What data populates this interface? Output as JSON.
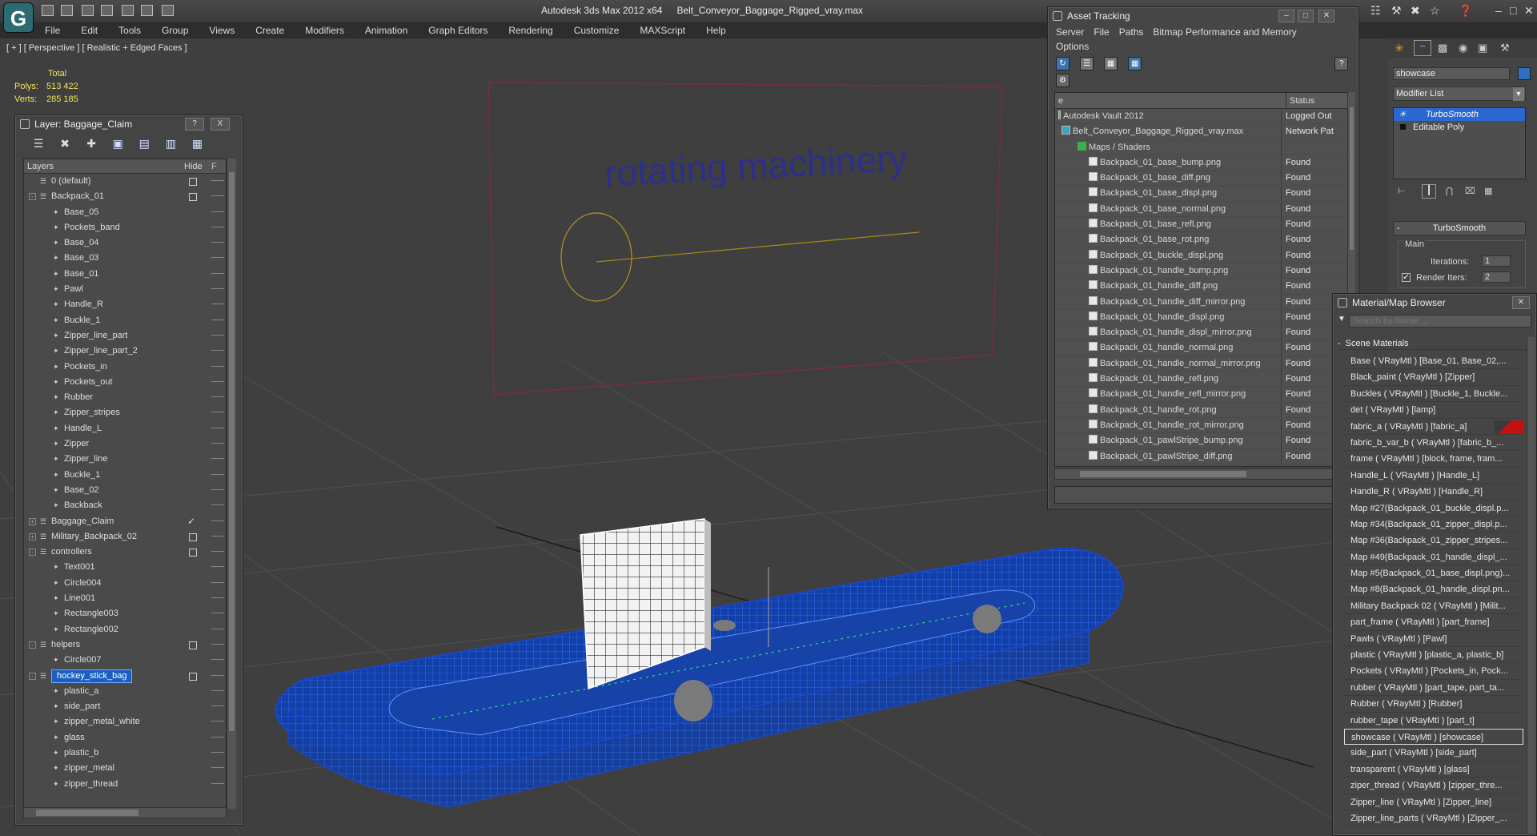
{
  "app": {
    "logo": "G",
    "title": "Autodesk 3ds Max  2012 x64",
    "file": "Belt_Conveyor_Baggage_Rigged_vray.max"
  },
  "menu": [
    "File",
    "Edit",
    "Tools",
    "Group",
    "Views",
    "Create",
    "Modifiers",
    "Animation",
    "Graph Editors",
    "Rendering",
    "Customize",
    "MAXScript",
    "Help"
  ],
  "viewport": {
    "label": "[ + ] [ Perspective ] [ Realistic + Edged Faces ]",
    "stats_header": "Total",
    "polys_label": "Polys:",
    "polys_value": "513 422",
    "verts_label": "Verts:",
    "verts_value": "285 185",
    "scene_text": "rotating machinery"
  },
  "layer_panel": {
    "title": "Layer: Baggage_Claim",
    "help_btn": "?",
    "close_btn": "X",
    "col_layers": "Layers",
    "col_hide": "Hide",
    "col_f": "F",
    "rows": [
      {
        "name": "0 (default)",
        "depth": 0,
        "box": true,
        "check": false,
        "expander": ""
      },
      {
        "name": "Backpack_01",
        "depth": 0,
        "box": true,
        "check": false,
        "expander": "-"
      },
      {
        "name": "Base_05",
        "depth": 1
      },
      {
        "name": "Pockets_band",
        "depth": 1
      },
      {
        "name": "Base_04",
        "depth": 1
      },
      {
        "name": "Base_03",
        "depth": 1
      },
      {
        "name": "Base_01",
        "depth": 1
      },
      {
        "name": "Pawl",
        "depth": 1
      },
      {
        "name": "Handle_R",
        "depth": 1
      },
      {
        "name": "Buckle_1",
        "depth": 1
      },
      {
        "name": "Zipper_line_part",
        "depth": 1
      },
      {
        "name": "Zipper_line_part_2",
        "depth": 1
      },
      {
        "name": "Pockets_in",
        "depth": 1
      },
      {
        "name": "Pockets_out",
        "depth": 1
      },
      {
        "name": "Rubber",
        "depth": 1
      },
      {
        "name": "Zipper_stripes",
        "depth": 1
      },
      {
        "name": "Handle_L",
        "depth": 1
      },
      {
        "name": "Zipper",
        "depth": 1
      },
      {
        "name": "Zipper_line",
        "depth": 1
      },
      {
        "name": "Buckle_1",
        "depth": 1
      },
      {
        "name": "Base_02",
        "depth": 1
      },
      {
        "name": "Backback",
        "depth": 1
      },
      {
        "name": "Baggage_Claim",
        "depth": 0,
        "check": true,
        "expander": "+"
      },
      {
        "name": "Military_Backpack_02",
        "depth": 0,
        "box": true,
        "expander": "+"
      },
      {
        "name": "controllers",
        "depth": 0,
        "box": true,
        "expander": "-"
      },
      {
        "name": "Text001",
        "depth": 1
      },
      {
        "name": "Circle004",
        "depth": 1
      },
      {
        "name": "Line001",
        "depth": 1
      },
      {
        "name": "Rectangle003",
        "depth": 1
      },
      {
        "name": "Rectangle002",
        "depth": 1
      },
      {
        "name": "helpers",
        "depth": 0,
        "box": true,
        "expander": "-"
      },
      {
        "name": "Circle007",
        "depth": 1
      },
      {
        "name": "hockey_stick_bag",
        "depth": 0,
        "box": true,
        "expander": "-",
        "selected": true
      },
      {
        "name": "plastic_a",
        "depth": 1
      },
      {
        "name": "side_part",
        "depth": 1
      },
      {
        "name": "zipper_metal_white",
        "depth": 1
      },
      {
        "name": "glass",
        "depth": 1
      },
      {
        "name": "plastic_b",
        "depth": 1
      },
      {
        "name": "zipper_metal",
        "depth": 1
      },
      {
        "name": "zipper_thread",
        "depth": 1
      }
    ]
  },
  "asset_tracking": {
    "title": "Asset Tracking",
    "menu": [
      "Server",
      "File",
      "Paths",
      "Bitmap Performance and Memory"
    ],
    "menu2": [
      "Options"
    ],
    "col_name": "e",
    "col_status": "Status",
    "rows": [
      {
        "name": "Autodesk Vault 2012",
        "status": "Logged Out",
        "depth": 0,
        "icon": "vault"
      },
      {
        "name": "Belt_Conveyor_Baggage_Rigged_vray.max",
        "status": "Network Pat",
        "depth": 0,
        "icon": "max"
      },
      {
        "name": "Maps / Shaders",
        "status": "",
        "depth": 1,
        "icon": "maps"
      },
      {
        "name": "Backpack_01_base_bump.png",
        "status": "Found",
        "depth": 2
      },
      {
        "name": "Backpack_01_base_diff.png",
        "status": "Found",
        "depth": 2
      },
      {
        "name": "Backpack_01_base_displ.png",
        "status": "Found",
        "depth": 2
      },
      {
        "name": "Backpack_01_base_normal.png",
        "status": "Found",
        "depth": 2
      },
      {
        "name": "Backpack_01_base_refl.png",
        "status": "Found",
        "depth": 2
      },
      {
        "name": "Backpack_01_base_rot.png",
        "status": "Found",
        "depth": 2
      },
      {
        "name": "Backpack_01_buckle_displ.png",
        "status": "Found",
        "depth": 2
      },
      {
        "name": "Backpack_01_handle_bump.png",
        "status": "Found",
        "depth": 2
      },
      {
        "name": "Backpack_01_handle_diff.png",
        "status": "Found",
        "depth": 2
      },
      {
        "name": "Backpack_01_handle_diff_mirror.png",
        "status": "Found",
        "depth": 2
      },
      {
        "name": "Backpack_01_handle_displ.png",
        "status": "Found",
        "depth": 2
      },
      {
        "name": "Backpack_01_handle_displ_mirror.png",
        "status": "Found",
        "depth": 2
      },
      {
        "name": "Backpack_01_handle_normal.png",
        "status": "Found",
        "depth": 2
      },
      {
        "name": "Backpack_01_handle_normal_mirror.png",
        "status": "Found",
        "depth": 2
      },
      {
        "name": "Backpack_01_handle_refl.png",
        "status": "Found",
        "depth": 2
      },
      {
        "name": "Backpack_01_handle_refl_mirror.png",
        "status": "Found",
        "depth": 2
      },
      {
        "name": "Backpack_01_handle_rot.png",
        "status": "Found",
        "depth": 2
      },
      {
        "name": "Backpack_01_handle_rot_mirror.png",
        "status": "Found",
        "depth": 2
      },
      {
        "name": "Backpack_01_pawlStripe_bump.png",
        "status": "Found",
        "depth": 2
      },
      {
        "name": "Backpack_01_pawlStripe_diff.png",
        "status": "Found",
        "depth": 2
      }
    ]
  },
  "command_panel": {
    "object_name": "showcase",
    "modifier_list": "Modifier List",
    "stack": [
      "TurboSmooth",
      "Editable Poly"
    ],
    "rollout_title": "TurboSmooth",
    "group_main": "Main",
    "iterations_label": "Iterations:",
    "iterations_value": "1",
    "render_iters_label": "Render Iters:",
    "render_iters_value": "2"
  },
  "material_browser": {
    "title": "Material/Map Browser",
    "search_placeholder": "Search by Name ...",
    "section": "Scene Materials",
    "rows": [
      "Base  ( VRayMtl ) [Base_01, Base_02,...",
      "Black_paint  ( VRayMtl ) [Zipper]",
      "Buckles  ( VRayMtl ) [Buckle_1, Buckle...",
      "det  ( VRayMtl ) [lamp]",
      "fabric_a  ( VRayMtl ) [fabric_a]",
      "fabric_b_var_b  ( VRayMtl ) [fabric_b_...",
      "frame  ( VRayMtl ) [block, frame, fram...",
      "Handle_L  ( VRayMtl ) [Handle_L]",
      "Handle_R  ( VRayMtl ) [Handle_R]",
      "Map #27(Backpack_01_buckle_displ.p...",
      "Map #34(Backpack_01_zipper_displ.p...",
      "Map #36(Backpack_01_zipper_stripes...",
      "Map #49(Backpack_01_handle_displ_...",
      "Map #5(Backpack_01_base_displ.png)...",
      "Map #8(Backpack_01_handle_displ.pn...",
      "Military Backpack 02  ( VRayMtl ) [Milit...",
      "part_frame  ( VRayMtl ) [part_frame]",
      "Pawls  ( VRayMtl ) [Pawl]",
      "plastic  ( VRayMtl ) [plastic_a, plastic_b]",
      "Pockets  ( VRayMtl ) [Pockets_in, Pock...",
      "rubber  ( VRayMtl ) [part_tape, part_ta...",
      "Rubber  ( VRayMtl ) [Rubber]",
      "rubber_tape  ( VRayMtl ) [part_t]",
      "showcase  ( VRayMtl ) [showcase]",
      "side_part  ( VRayMtl ) [side_part]",
      "transparent  ( VRayMtl ) [glass]",
      "ziper_thread  ( VRayMtl ) [zipper_thre...",
      "Zipper_line  ( VRayMtl ) [Zipper_line]",
      "Zipper_line_parts  ( VRayMtl ) [Zipper_..."
    ],
    "selected_index": 23,
    "swatch_index": 4
  },
  "colors": {
    "accent": "#1a5fbf",
    "viewport": "#3f3f3f",
    "found": "#e8e8e8",
    "wire": "#1f55d8"
  }
}
